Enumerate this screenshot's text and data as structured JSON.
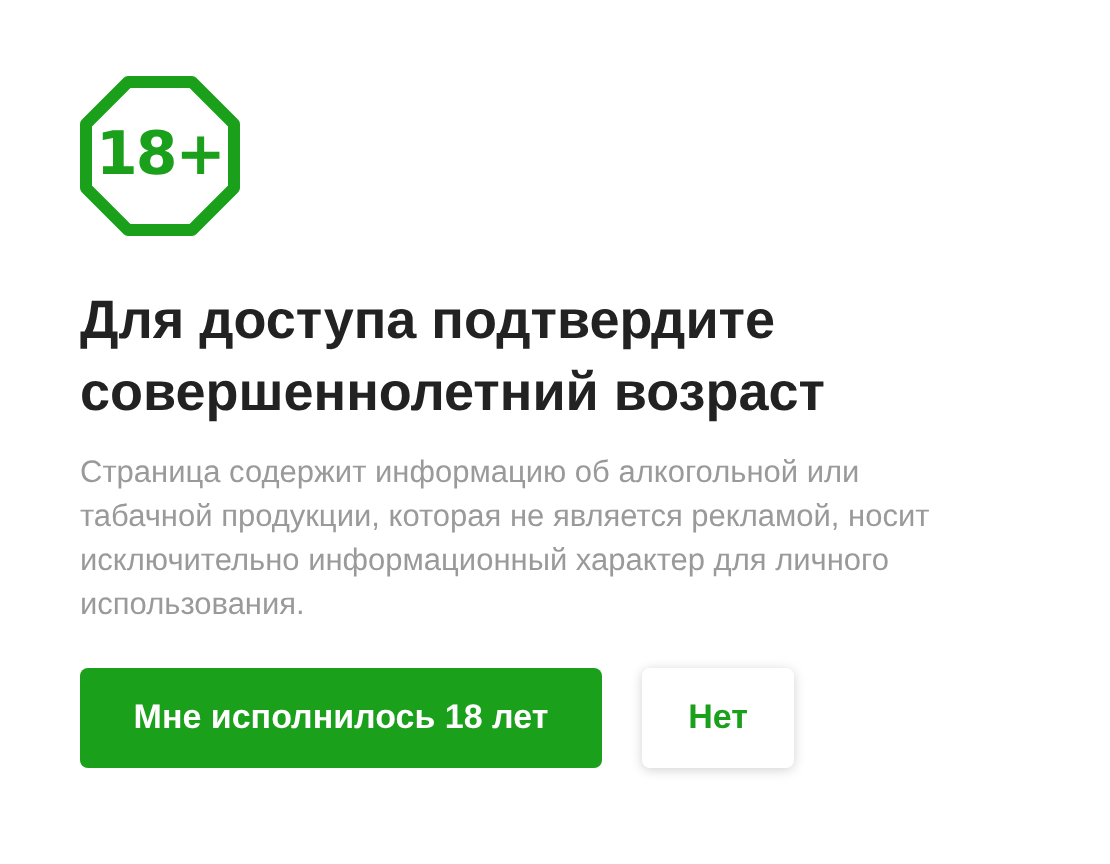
{
  "badge": {
    "text": "18+"
  },
  "title": "Для доступа подтвердите совершеннолетний возраст",
  "description": "Страница содержит информацию об алкогольной или табачной продукции, которая не является рекламой, носит исключительно информационный характер для личного использования.",
  "buttons": [
    {
      "label": "Мне исполнилось 18 лет",
      "kind": "primary"
    },
    {
      "label": "Нет",
      "kind": "secondary"
    }
  ]
}
